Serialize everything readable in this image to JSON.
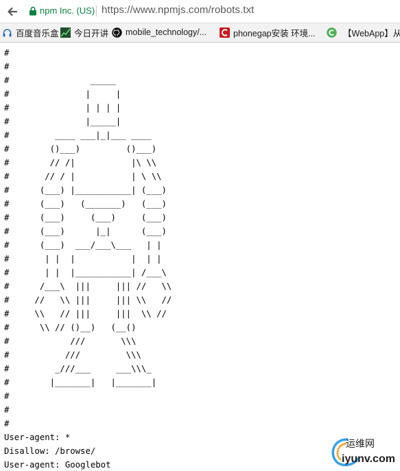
{
  "address_bar": {
    "site_identity": "npm Inc. (US)",
    "url": "https://www.npmjs.com/robots.txt",
    "secure_color": "#0b8043"
  },
  "bookmarks": [
    {
      "label": "百度音乐盒",
      "icon": "headphones-icon"
    },
    {
      "label": "今日开讲",
      "icon": "chart-icon"
    },
    {
      "label": "mobile_technology/...",
      "icon": "github-icon"
    },
    {
      "label": "phonegap安装 环境...",
      "icon": "csdn-icon"
    },
    {
      "label": "",
      "icon": "green-c-icon"
    },
    {
      "label": "【WebApp】从",
      "icon": ""
    }
  ],
  "robots_lines": [
    "#",
    "#",
    "#                _____",
    "#               |     |",
    "#               | | | |",
    "#               |_____|",
    "#         ____ ___|_|___ ____",
    "#        ()___)         ()___)",
    "#        // /|           |\\ \\\\",
    "#       // / |           | \\ \\\\",
    "#      (___) |___________| (___)",
    "#      (___)   (_______)   (___)",
    "#      (___)     (___)     (___)",
    "#      (___)      |_|      (___)",
    "#      (___)  ___/___\\___   | |",
    "#       | |  |           |  | |",
    "#       | |  |___________| /___\\",
    "#      /___\\  |||     ||| //   \\\\",
    "#     //   \\\\ |||     ||| \\\\   //",
    "#     \\\\   // |||     |||  \\\\ //",
    "#      \\\\ // ()__)   (__()",
    "#            ///       \\\\\\",
    "#           ///         \\\\\\",
    "#         _///___     ___\\\\\\_",
    "#        |_______|   |_______|",
    "#",
    "#",
    "#",
    "User-agent: *",
    "Disallow: /browse/",
    "User-agent: Googlebot"
  ],
  "watermark": {
    "chinese": "运维网",
    "domain": "iyunv.com",
    "icon": "watermark-swirl-icon"
  }
}
